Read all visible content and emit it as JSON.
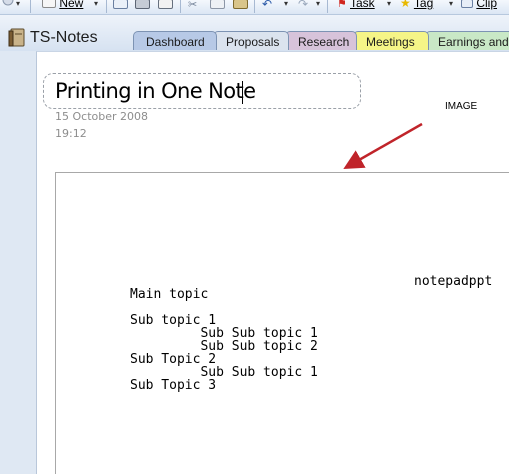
{
  "toolbar": {
    "new_label": "New",
    "task_label": "Task",
    "tag_label": "Tag",
    "clip_label": "Clip"
  },
  "notebook": {
    "title": "TS-Notes",
    "tabs": [
      {
        "label": "Dashboard",
        "color": "#b7c9e6"
      },
      {
        "label": "Proposals",
        "color": "#dbe3ee"
      },
      {
        "label": "Research",
        "color": "#d7c3da"
      },
      {
        "label": "Meetings",
        "color": "#f5f587"
      },
      {
        "label": "Earnings and",
        "color": "#c9e8c6"
      }
    ]
  },
  "page": {
    "title": "Printing in One Note",
    "date": "15 October 2008",
    "time": "19:12",
    "image_label": "IMAGE"
  },
  "embedded_image": {
    "header": "notepadppt",
    "lines": [
      "Main topic",
      "",
      "Sub topic 1",
      "         Sub Sub topic 1",
      "         Sub Sub topic 2",
      "Sub Topic 2",
      "         Sub Sub topic 1",
      "Sub Topic 3"
    ]
  },
  "colors": {
    "arrow": "#c0242a",
    "page_bg": "#ffffff",
    "chrome_bg": "#dfe8f3"
  }
}
